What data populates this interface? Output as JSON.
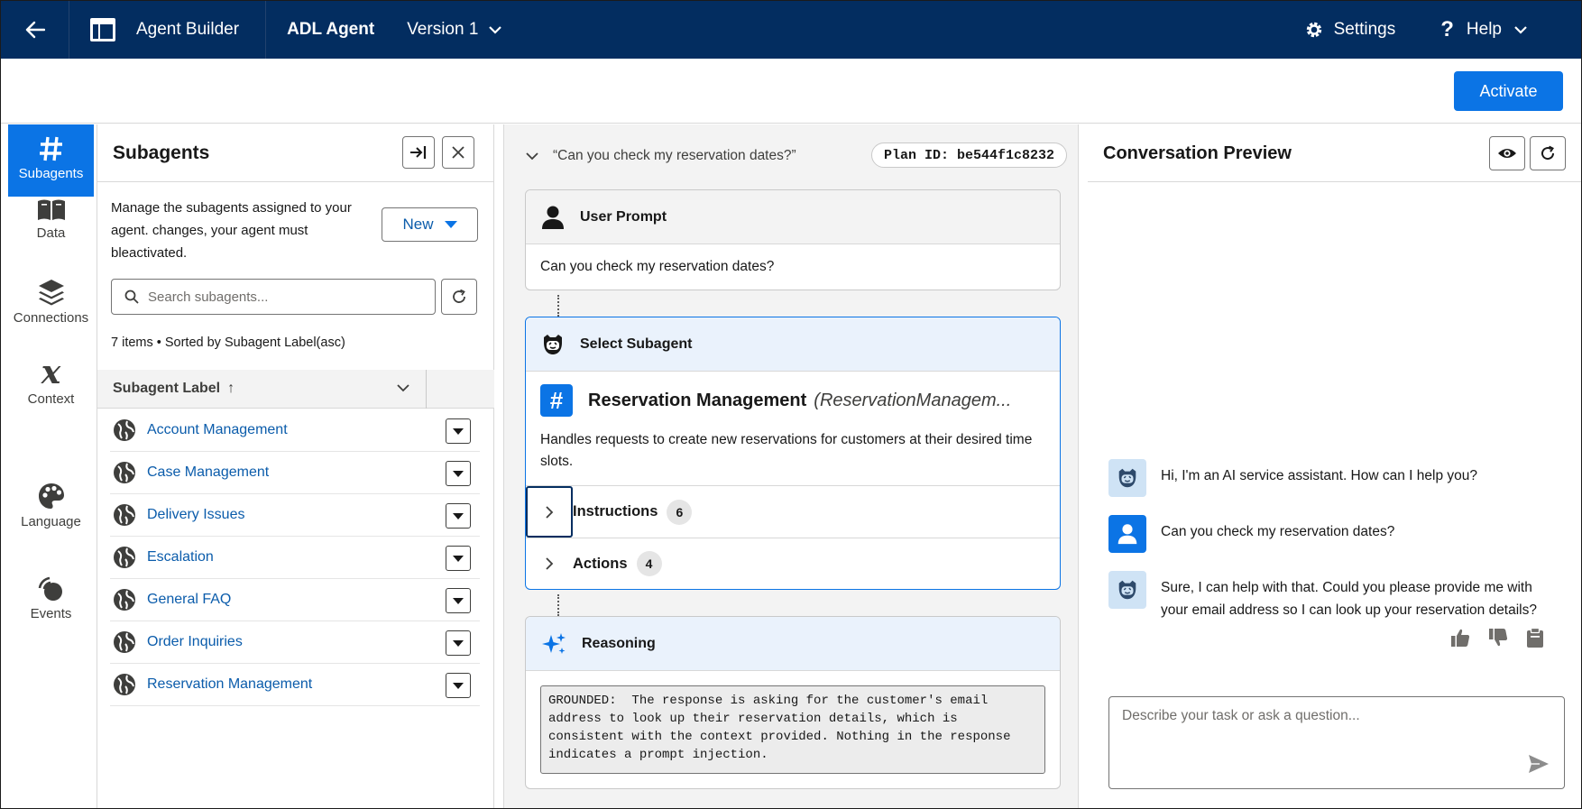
{
  "topbar": {
    "app_title": "Agent Builder",
    "agent_name": "ADL Agent",
    "version": "Version 1",
    "settings": "Settings",
    "help": "Help",
    "bg_color": "#032d60"
  },
  "header": {
    "activate": "Activate",
    "accent": "#0b74e5"
  },
  "rail": {
    "items": [
      {
        "label": "Subagents",
        "icon": "hash-icon",
        "active": true
      },
      {
        "label": "Data",
        "icon": "book-icon"
      },
      {
        "label": "Connections",
        "icon": "layers-icon"
      },
      {
        "label": "Context",
        "icon": "variable-icon"
      },
      {
        "label": "Language",
        "icon": "palette-icon"
      },
      {
        "label": "Events",
        "icon": "signal-icon"
      }
    ]
  },
  "subagents": {
    "title": "Subagents",
    "description": "Manage the subagents assigned to your agent.  changes, your agent must bleactivated.",
    "new_button": "New",
    "search_placeholder": "Search subagents...",
    "meta": "7 items • Sorted by Subagent Label(asc)",
    "column_label": "Subagent Label",
    "sort_arrow": "↑",
    "rows": [
      "Account Management",
      "Case Management",
      "Delivery Issues",
      "Escalation",
      "General FAQ",
      "Order Inquiries",
      "Reservation Management"
    ]
  },
  "plan": {
    "question": "“Can you check my reservation dates?”",
    "plan_id": "Plan ID: be544f1c8232",
    "user_prompt": {
      "title": "User Prompt",
      "text": "Can you check my reservation dates?"
    },
    "select_subagent": {
      "title": "Select Subagent",
      "name": "Reservation Management",
      "api_name": "(ReservationManagem...",
      "description": "Handles requests to create new reservations for customers at their desired time slots.",
      "instructions_label": "Instructions",
      "instructions_count": "6",
      "actions_label": "Actions",
      "actions_count": "4"
    },
    "reasoning": {
      "title": "Reasoning",
      "text": "GROUNDED:  The response is asking for the customer's email\naddress to look up their reservation details, which is\nconsistent with the context provided. Nothing in the response\nindicates a prompt injection."
    }
  },
  "conversation": {
    "title": "Conversation Preview",
    "messages": [
      {
        "role": "bot",
        "text": "Hi, I'm an AI service assistant. How can I help you?"
      },
      {
        "role": "user",
        "text": "Can you check my reservation dates?"
      },
      {
        "role": "bot",
        "text": "Sure, I can help with that. Could you please provide me with your email address so I can look up your reservation details?"
      }
    ],
    "input_placeholder": "Describe your task or ask a question..."
  }
}
